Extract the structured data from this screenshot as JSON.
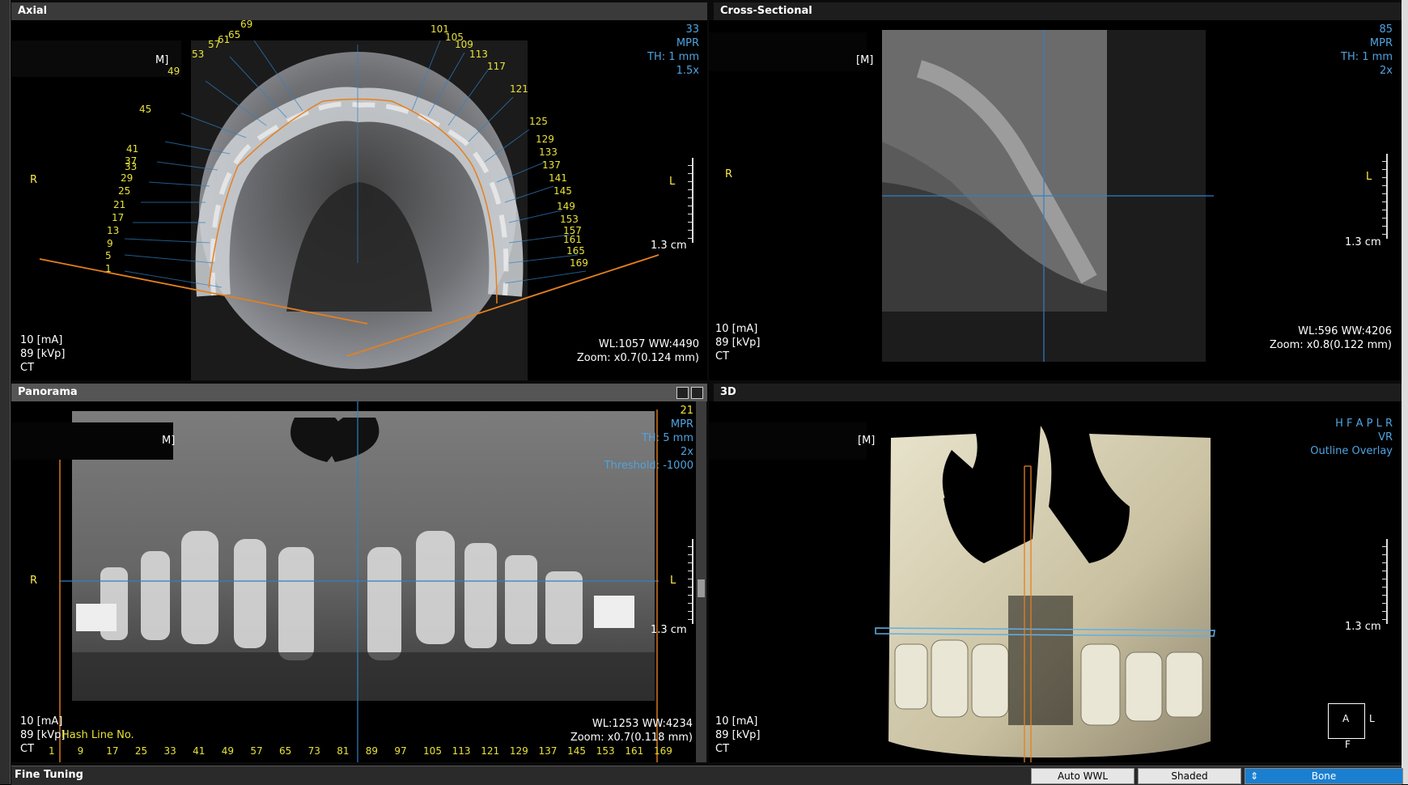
{
  "axial": {
    "title": "Axial",
    "tr": [
      "33",
      "MPR",
      "TH: 1 mm",
      "1.5x"
    ],
    "r": "R",
    "l": "L",
    "scale": "1.3 cm",
    "bl": [
      "10 [mA]",
      "89 [kVp]",
      "CT"
    ],
    "br": [
      "WL:1057 WW:4490",
      "Zoom: x0.7(0.124 mm)"
    ],
    "markers": [
      "1",
      "5",
      "9",
      "13",
      "17",
      "21",
      "25",
      "29",
      "33",
      "37",
      "41",
      "45",
      "49",
      "53",
      "57",
      "61",
      "65",
      "69",
      "101",
      "105",
      "109",
      "113",
      "117",
      "121",
      "125",
      "129",
      "133",
      "137",
      "141",
      "145",
      "149",
      "153",
      "157",
      "161",
      "165",
      "169"
    ],
    "partial_header": "M]"
  },
  "cross": {
    "title": "Cross-Sectional",
    "tr": [
      "85",
      "MPR",
      "TH: 1 mm",
      "2x"
    ],
    "r": "R",
    "l": "L",
    "scale": "1.3 cm",
    "bl": [
      "10 [mA]",
      "89 [kVp]",
      "CT"
    ],
    "br": [
      "WL:596 WW:4206",
      "Zoom: x0.8(0.122 mm)"
    ],
    "partial_header": "[M]"
  },
  "pano": {
    "title": "Panorama",
    "tr": [
      "21",
      "MPR",
      "TH: 5 mm",
      "2x",
      "Threshold: -1000"
    ],
    "r": "R",
    "l": "L",
    "scale": "1.3 cm",
    "bl": [
      "10 [mA]",
      "89 [kVp]",
      "CT"
    ],
    "hash": "Hash Line No.",
    "br": [
      "WL:1253 WW:4234",
      "Zoom: x0.7(0.118 mm)"
    ],
    "numbers": [
      "1",
      "9",
      "17",
      "25",
      "33",
      "41",
      "49",
      "57",
      "65",
      "73",
      "81",
      "89",
      "97",
      "105",
      "113",
      "121",
      "129",
      "137",
      "145",
      "153",
      "161",
      "169"
    ],
    "partial_header": "M]"
  },
  "vr3d": {
    "title": "3D",
    "tr": [
      "H F A P L R",
      "VR",
      "Outline Overlay"
    ],
    "scale": "1.3 cm",
    "bl": [
      "10 [mA]",
      "89 [kVp]",
      "CT"
    ],
    "cube": {
      "a": "A",
      "l": "L",
      "f": "F"
    },
    "partial_header": "[M]"
  },
  "bottom": {
    "title": "Fine Tuning",
    "auto": "Auto WWL",
    "shaded": "Shaded",
    "bone": "Bone"
  },
  "colors": {
    "overlay_blue": "#4fa3e0",
    "marker_yellow": "#e8e23a",
    "curve_orange": "#e5801f",
    "selected_button": "#1a7fd1"
  }
}
